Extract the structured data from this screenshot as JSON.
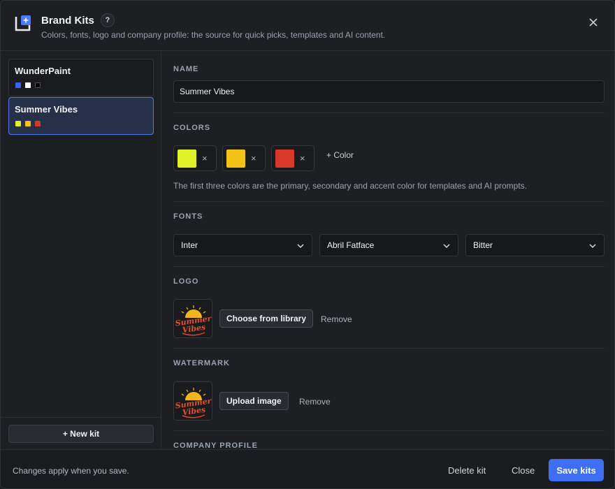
{
  "header": {
    "title": "Brand Kits",
    "help_label": "?",
    "subtitle": "Colors, fonts, logo and company profile: the source for quick picks, templates and AI content."
  },
  "sidebar": {
    "kits": [
      {
        "name": "WunderPaint",
        "colors": [
          "#3b63f0",
          "#ffffff",
          "#000000"
        ],
        "active": false
      },
      {
        "name": "Summer Vibes",
        "colors": [
          "#dff227",
          "#f4c318",
          "#d8372a"
        ],
        "active": true
      }
    ],
    "new_kit_label": "+ New kit"
  },
  "main": {
    "name": {
      "label": "NAME",
      "value": "Summer Vibes"
    },
    "colors": {
      "label": "COLORS",
      "items": [
        "#dff227",
        "#f4c318",
        "#d8372a"
      ],
      "remove_label": "×",
      "add_label": "+ Color",
      "hint": "The first three colors are the primary, secondary and accent color for templates and AI prompts."
    },
    "fonts": {
      "label": "FONTS",
      "selected": [
        "Inter",
        "Abril Fatface",
        "Bitter"
      ]
    },
    "logo": {
      "label": "LOGO",
      "choose_label": "Choose from library",
      "remove_label": "Remove",
      "image_text": [
        "Summer",
        "Vibes"
      ]
    },
    "watermark": {
      "label": "WATERMARK",
      "upload_label": "Upload image",
      "remove_label": "Remove",
      "image_text": [
        "Summer",
        "Vibes"
      ]
    },
    "company_profile": {
      "label": "COMPANY PROFILE"
    }
  },
  "footer": {
    "note": "Changes apply when you save.",
    "delete_label": "Delete kit",
    "close_label": "Close",
    "save_label": "Save kits"
  },
  "colors": {
    "accent": "#3e6ff2",
    "selected_border": "#4d78e6"
  },
  "icons": {
    "app": "brand-kit-icon",
    "close": "close-icon",
    "chevron": "chevron-down-icon"
  }
}
